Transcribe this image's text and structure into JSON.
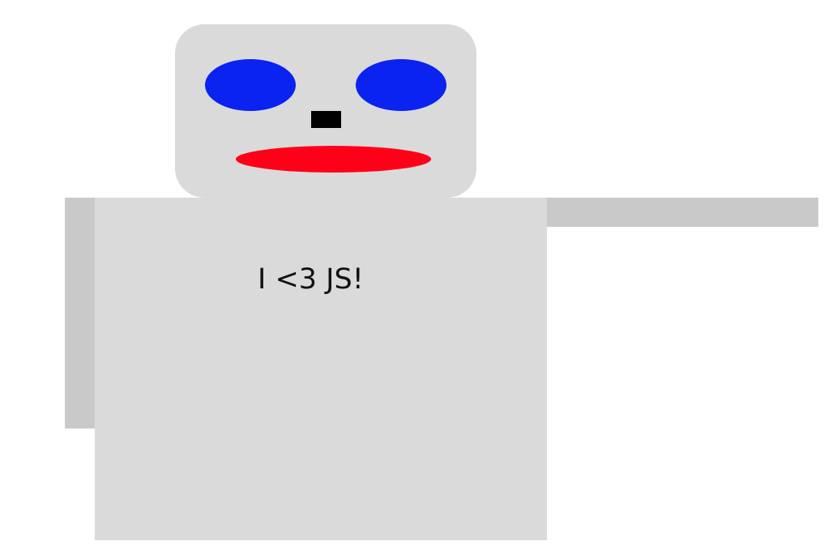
{
  "robot": {
    "shirt_text": "I <3 JS!",
    "colors": {
      "head": "#dadada",
      "body": "#dadada",
      "arms": "#c9c9c9",
      "eyes": "#0a23f0",
      "nose": "#000000",
      "mouth": "#ff0019",
      "background": "#ffffff"
    }
  }
}
